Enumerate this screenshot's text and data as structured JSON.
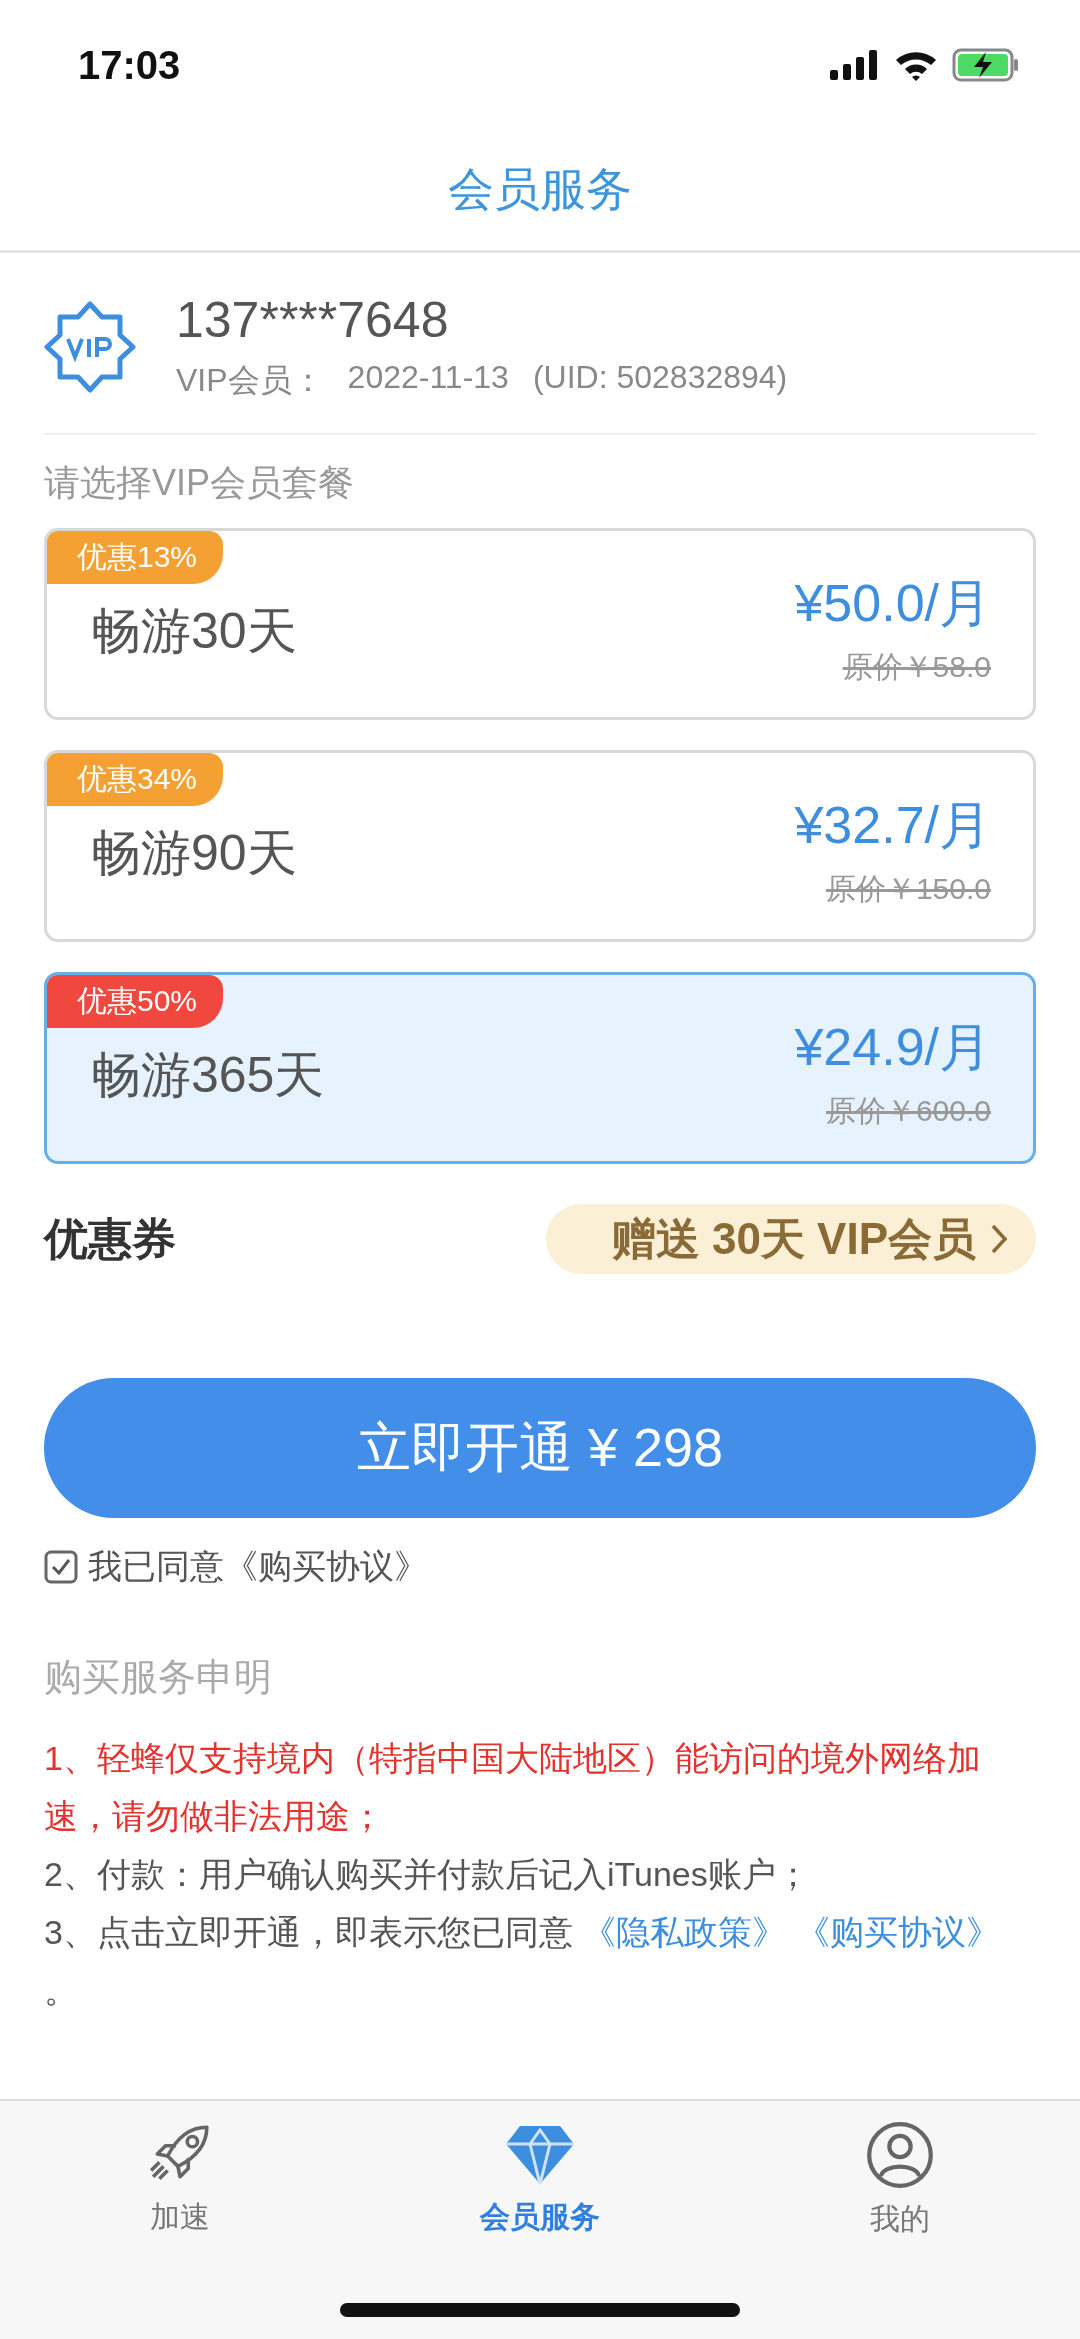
{
  "status_bar": {
    "time": "17:03"
  },
  "header": {
    "title": "会员服务"
  },
  "account": {
    "phone": "137****7648",
    "membership_label": "VIP会员：",
    "expiry": "2022-11-13",
    "uid": "(UID: 502832894)"
  },
  "plans_heading": "请选择VIP会员套餐",
  "plans": [
    {
      "badge": "优惠13%",
      "color": "#f5a033",
      "name": "畅游30天",
      "price": "¥50.0/月",
      "original_price": "原价￥58.0",
      "selected": false
    },
    {
      "badge": "优惠34%",
      "color": "#f5a033",
      "name": "畅游90天",
      "price": "¥32.7/月",
      "original_price": "原价￥150.0",
      "selected": false
    },
    {
      "badge": "优惠50%",
      "color": "#f0483e",
      "name": "畅游365天",
      "price": "¥24.9/月",
      "original_price": "原价￥600.0",
      "selected": true
    }
  ],
  "coupon": {
    "label": "优惠券",
    "offer": "赠送 30天 VIP会员"
  },
  "purchase_button": "立即开通 ¥ 298",
  "agreement": {
    "checked": true,
    "text": "我已同意《购买协议》"
  },
  "statement": {
    "title": "购买服务申明",
    "items": [
      {
        "kind": "warning",
        "text": "1、轻蜂仅支持境内（特指中国大陆地区）能访问的境外网络加速，请勿做非法用途；"
      },
      {
        "kind": "plain",
        "text": "2、付款：用户确认购买并付款后记入iTunes账户；"
      },
      {
        "kind": "links",
        "text": "3、点击立即开通，即表示您已同意",
        "links": [
          "《隐私政策》",
          "《购买协议》"
        ],
        "end": "。"
      }
    ]
  },
  "tab_bar": [
    {
      "kind": "rocket",
      "label": "加速",
      "selected": false
    },
    {
      "kind": "diamond",
      "label": "会员服务",
      "selected": true
    },
    {
      "kind": "person",
      "label": "我的",
      "selected": false
    }
  ]
}
